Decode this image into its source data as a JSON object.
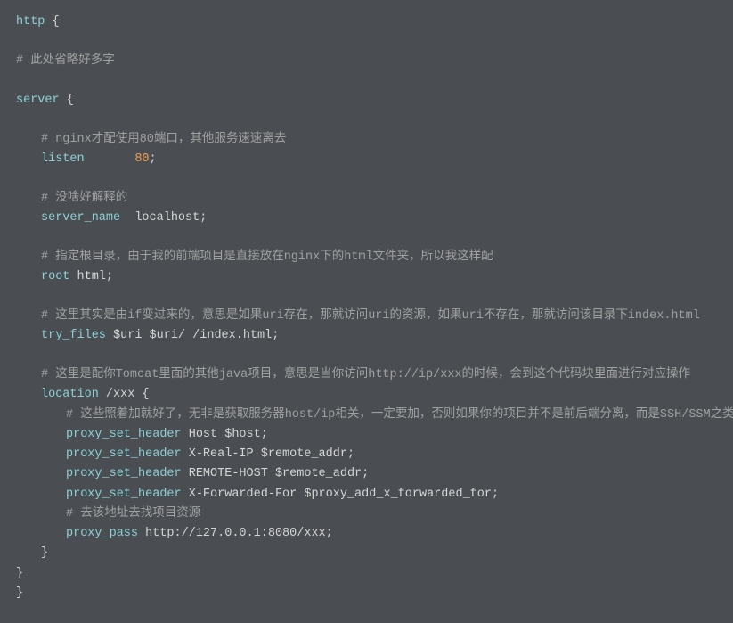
{
  "code": {
    "l1_kw": "http",
    "l1_brace": " {",
    "l2_cmt": "# 此处省略好多字",
    "l3_kw": "server",
    "l3_brace": " {",
    "l4_cmt": "# nginx才配使用80端口，其他服务速速离去",
    "l5_kw": "listen",
    "l5_gap": "       ",
    "l5_num": "80",
    "l5_end": ";",
    "l6_cmt": "# 没啥好解释的",
    "l7_kw": "server_name",
    "l7_val": "  localhost;",
    "l8_cmt": "# 指定根目录，由于我的前端项目是直接放在nginx下的html文件夹，所以我这样配",
    "l9_kw": "root",
    "l9_val": " html;",
    "l10_cmt": "# 这里其实是由if变过来的，意思是如果uri存在，那就访问uri的资源，如果uri不存在，那就访问该目录下index.html",
    "l11_kw": "try_files",
    "l11_val": " $uri $uri/ /index.html;",
    "l12_cmt": "# 这里是配你Tomcat里面的其他java项目，意思是当你访问http://ip/xxx的时候，会到这个代码块里面进行对应操作",
    "l13_kw": "location",
    "l13_val": " /xxx ",
    "l13_brace": "{",
    "l14_cmt": "# 这些照着加就好了，无非是获取服务器host/ip相关，一定要加，否则如果你的项目并不是前后端分离，而是SSH/SSM之类的，前端会无法获取路由",
    "l15_kw": "proxy_set_header",
    "l15_val": " Host $host;",
    "l16_kw": "proxy_set_header",
    "l16_val": " X-Real-IP $remote_addr;",
    "l17_kw": "proxy_set_header",
    "l17_val": " REMOTE-HOST $remote_addr;",
    "l18_kw": "proxy_set_header",
    "l18_val": " X-Forwarded-For $proxy_add_x_forwarded_for;",
    "l19_cmt": "# 去该地址去找项目资源",
    "l20_kw": "proxy_pass",
    "l20_val": " http://127.0.0.1:8080/xxx;",
    "l21_brace": "}",
    "l22_brace": "}",
    "l23_brace": "}"
  }
}
